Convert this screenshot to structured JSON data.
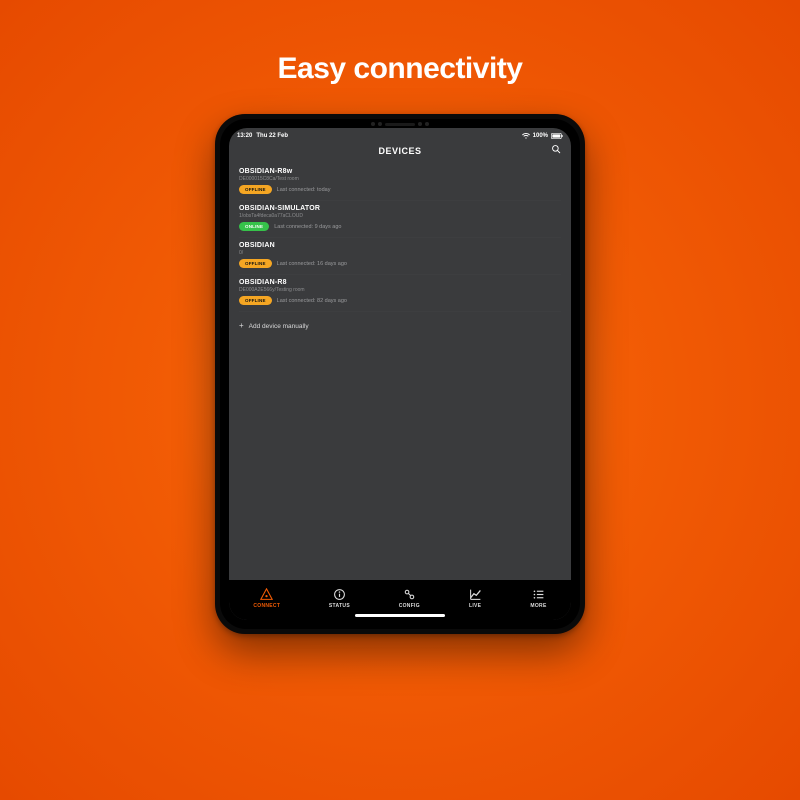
{
  "promo": {
    "headline": "Easy connectivity"
  },
  "statusBar": {
    "time": "13:20",
    "date": "Thu 22 Feb",
    "battery": "100%"
  },
  "header": {
    "title": "DEVICES"
  },
  "devices": [
    {
      "name": "OBSIDIAN-R8w",
      "subtitle": "DE000015C8Ca/Test room",
      "status": "OFFLINE",
      "statusClass": "offline",
      "lastConnected": "Last connected: today"
    },
    {
      "name": "OBSIDIAN-SIMULATOR",
      "subtitle": "1/obsTa4fdeca0a77aCLOUD",
      "status": "ONLINE",
      "statusClass": "online",
      "lastConnected": "Last connected: 9 days ago"
    },
    {
      "name": "OBSIDIAN",
      "subtitle": "0/",
      "status": "OFFLINE",
      "statusClass": "offline",
      "lastConnected": "Last connected: 16 days ago"
    },
    {
      "name": "OBSIDIAN-R8",
      "subtitle": "DE000A2E566y/Testing room",
      "status": "OFFLINE",
      "statusClass": "offline",
      "lastConnected": "Last connected: 82 days ago"
    }
  ],
  "addManual": {
    "label": "Add device manually"
  },
  "tabs": [
    {
      "id": "connect",
      "label": "CONNECT",
      "active": true
    },
    {
      "id": "status",
      "label": "STATUS",
      "active": false
    },
    {
      "id": "config",
      "label": "CONFIG",
      "active": false
    },
    {
      "id": "live",
      "label": "LIVE",
      "active": false
    },
    {
      "id": "more",
      "label": "MORE",
      "active": false
    }
  ]
}
